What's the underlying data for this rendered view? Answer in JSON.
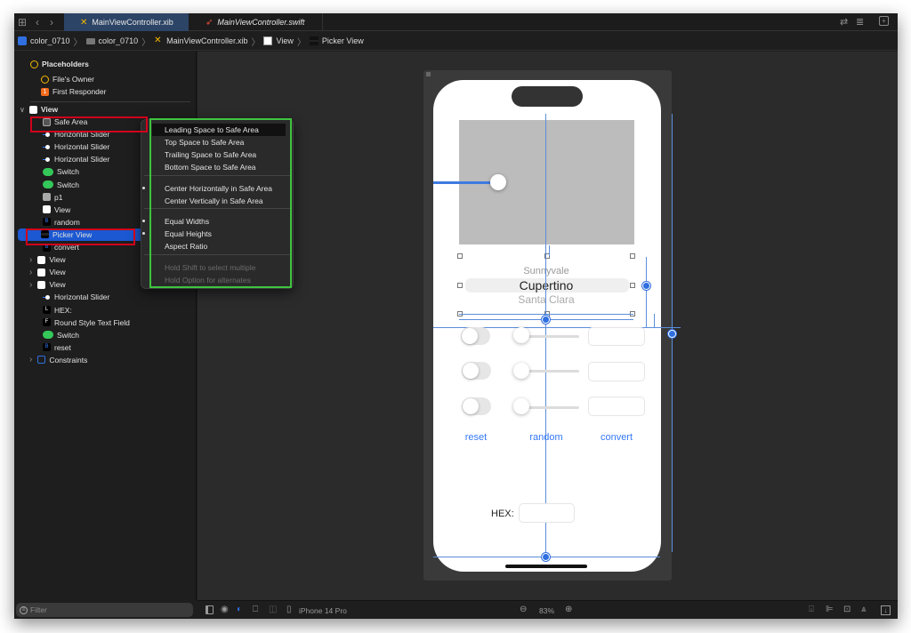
{
  "tabs": [
    {
      "label": "MainViewController.xib",
      "icon": "xib-icon",
      "active": true
    },
    {
      "label": "MainViewController.swift",
      "icon": "swift-icon",
      "active": false
    }
  ],
  "breadcrumb": [
    {
      "label": "color_0710",
      "icon": "project-icon"
    },
    {
      "label": "color_0710",
      "icon": "folder-icon"
    },
    {
      "label": "MainViewController.xib",
      "icon": "xib-icon"
    },
    {
      "label": "View",
      "icon": "view-icon"
    },
    {
      "label": "Picker View",
      "icon": "picker-view-icon"
    }
  ],
  "navigator": {
    "placeholders_header": "Placeholders",
    "placeholders": [
      {
        "label": "File's Owner",
        "icon": "cube-icon"
      },
      {
        "label": "First Responder",
        "icon": "first-responder-icon"
      }
    ],
    "view_header": "View",
    "items": [
      {
        "label": "Safe Area",
        "icon": "safe-area-icon"
      },
      {
        "label": "Horizontal Slider",
        "icon": "slider-icon"
      },
      {
        "label": "Horizontal Slider",
        "icon": "slider-icon"
      },
      {
        "label": "Horizontal Slider",
        "icon": "slider-icon"
      },
      {
        "label": "Switch",
        "icon": "switch-icon"
      },
      {
        "label": "Switch",
        "icon": "switch-icon"
      },
      {
        "label": "p1",
        "icon": "image-view-icon"
      },
      {
        "label": "View",
        "icon": "view-icon"
      },
      {
        "label": "random",
        "icon": "button-icon"
      },
      {
        "label": "Picker View",
        "icon": "picker-view-icon",
        "selected": true
      },
      {
        "label": "convert",
        "icon": "button-icon"
      },
      {
        "label": "View",
        "icon": "view-icon",
        "expandable": true
      },
      {
        "label": "View",
        "icon": "view-icon",
        "expandable": true
      },
      {
        "label": "View",
        "icon": "view-icon",
        "expandable": true
      },
      {
        "label": "Horizontal Slider",
        "icon": "slider-icon"
      },
      {
        "label": "HEX:",
        "icon": "label-icon"
      },
      {
        "label": "Round Style Text Field",
        "icon": "text-field-icon"
      },
      {
        "label": "Switch",
        "icon": "switch-icon"
      },
      {
        "label": "reset",
        "icon": "button-icon"
      },
      {
        "label": "Constraints",
        "icon": "constraints-icon",
        "expandable": true
      }
    ],
    "filter_placeholder": "Filter"
  },
  "context_menu": {
    "items": [
      {
        "label": "Leading Space to Safe Area",
        "highlighted": true
      },
      {
        "label": "Top Space to Safe Area"
      },
      {
        "label": "Trailing Space to Safe Area"
      },
      {
        "label": "Bottom Space to Safe Area"
      },
      {
        "label": "Center Horizontally in Safe Area",
        "bullet": true
      },
      {
        "label": "Center Vertically in Safe Area"
      },
      {
        "label": "Equal Widths",
        "bullet": true
      },
      {
        "label": "Equal Heights",
        "bullet": true
      },
      {
        "label": "Aspect Ratio"
      },
      {
        "label": "Hold Shift to select multiple",
        "disabled": true
      },
      {
        "label": "Hold Option for alternates",
        "disabled": true
      }
    ]
  },
  "canvas": {
    "picker_rows": [
      "Sunnyvale",
      "Cupertino",
      "Santa Clara"
    ],
    "buttons": {
      "reset": "reset",
      "random": "random",
      "convert": "convert"
    },
    "hex_label": "HEX:"
  },
  "bottom_bar": {
    "device": "iPhone 14 Pro",
    "zoom": "83%"
  },
  "colors": {
    "accent_blue": "#3478f6",
    "selection_blue": "#1b58d1",
    "highlight_red": "#d0021b",
    "highlight_green": "#3ec43e"
  }
}
